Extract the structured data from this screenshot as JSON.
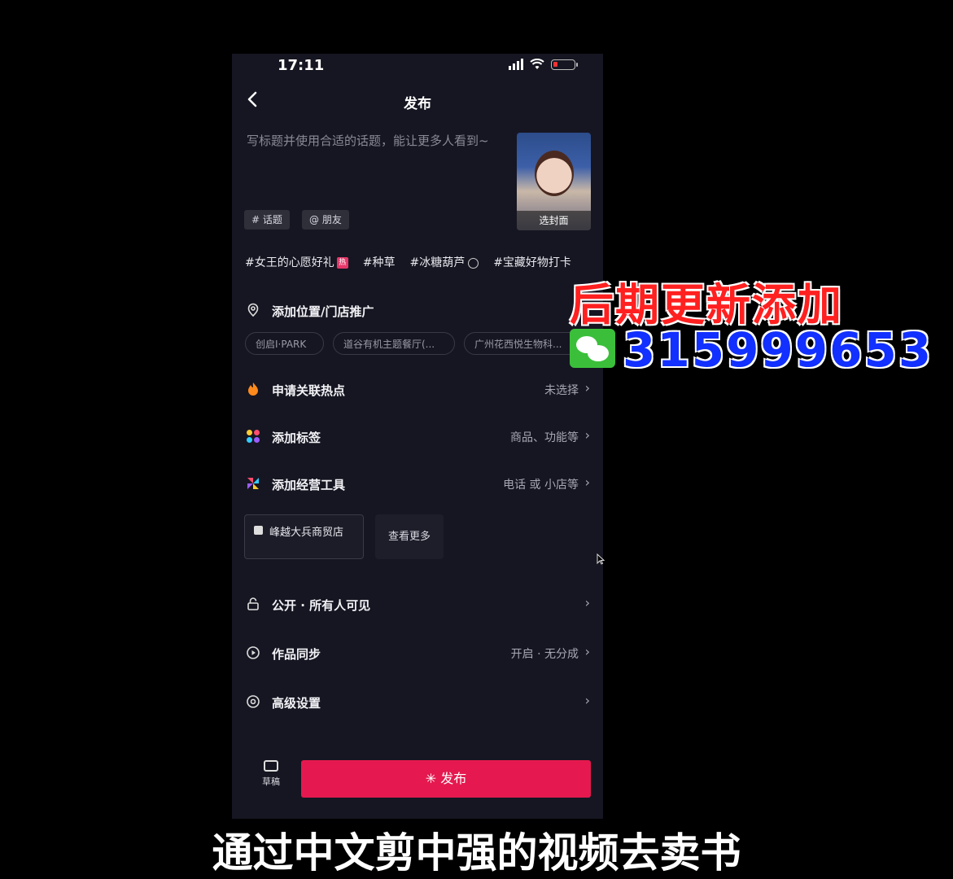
{
  "status_bar": {
    "time": "17:11"
  },
  "header": {
    "title": "发布"
  },
  "composer": {
    "placeholder": "写标题并使用合适的话题，能让更多人看到~",
    "cover_label": "选封面",
    "chips": [
      "# 话题",
      "@ 朋友"
    ]
  },
  "trending_topics": [
    {
      "text": "#女王的心愿好礼",
      "badge": "热"
    },
    {
      "text": "#种草"
    },
    {
      "text": "#冰糖葫芦",
      "icon": "clock-icon"
    },
    {
      "text": "#宝藏好物打卡"
    }
  ],
  "location": {
    "label": "添加位置/门店推广",
    "chips": [
      "创启I·PARK",
      "道谷有机主题餐厅(...",
      "广州花西悦生物科..."
    ]
  },
  "rows": {
    "hotspot": {
      "label": "申请关联热点",
      "value": "未选择"
    },
    "tags": {
      "label": "添加标签",
      "value": "商品、功能等"
    },
    "tools": {
      "label": "添加经营工具",
      "value": "电话 或 小店等"
    },
    "visibility": {
      "label": "公开 · 所有人可见",
      "value": ""
    },
    "sync": {
      "label": "作品同步",
      "value": "开启 · 无分成"
    },
    "advanced": {
      "label": "高级设置",
      "value": ""
    }
  },
  "store": {
    "name": "峰越大兵商贸店",
    "more": "查看更多"
  },
  "footer": {
    "draft_label": "草稿",
    "publish_label": "发布"
  },
  "overlay": {
    "promo_text": "后期更新添加",
    "wechat_id": "315999653",
    "subtitle": "通过中文剪中强的视频去卖书"
  },
  "colors": {
    "accent": "#e5194f",
    "background": "#161622",
    "promo_red": "#ff2020",
    "promo_blue": "#1230ff"
  }
}
